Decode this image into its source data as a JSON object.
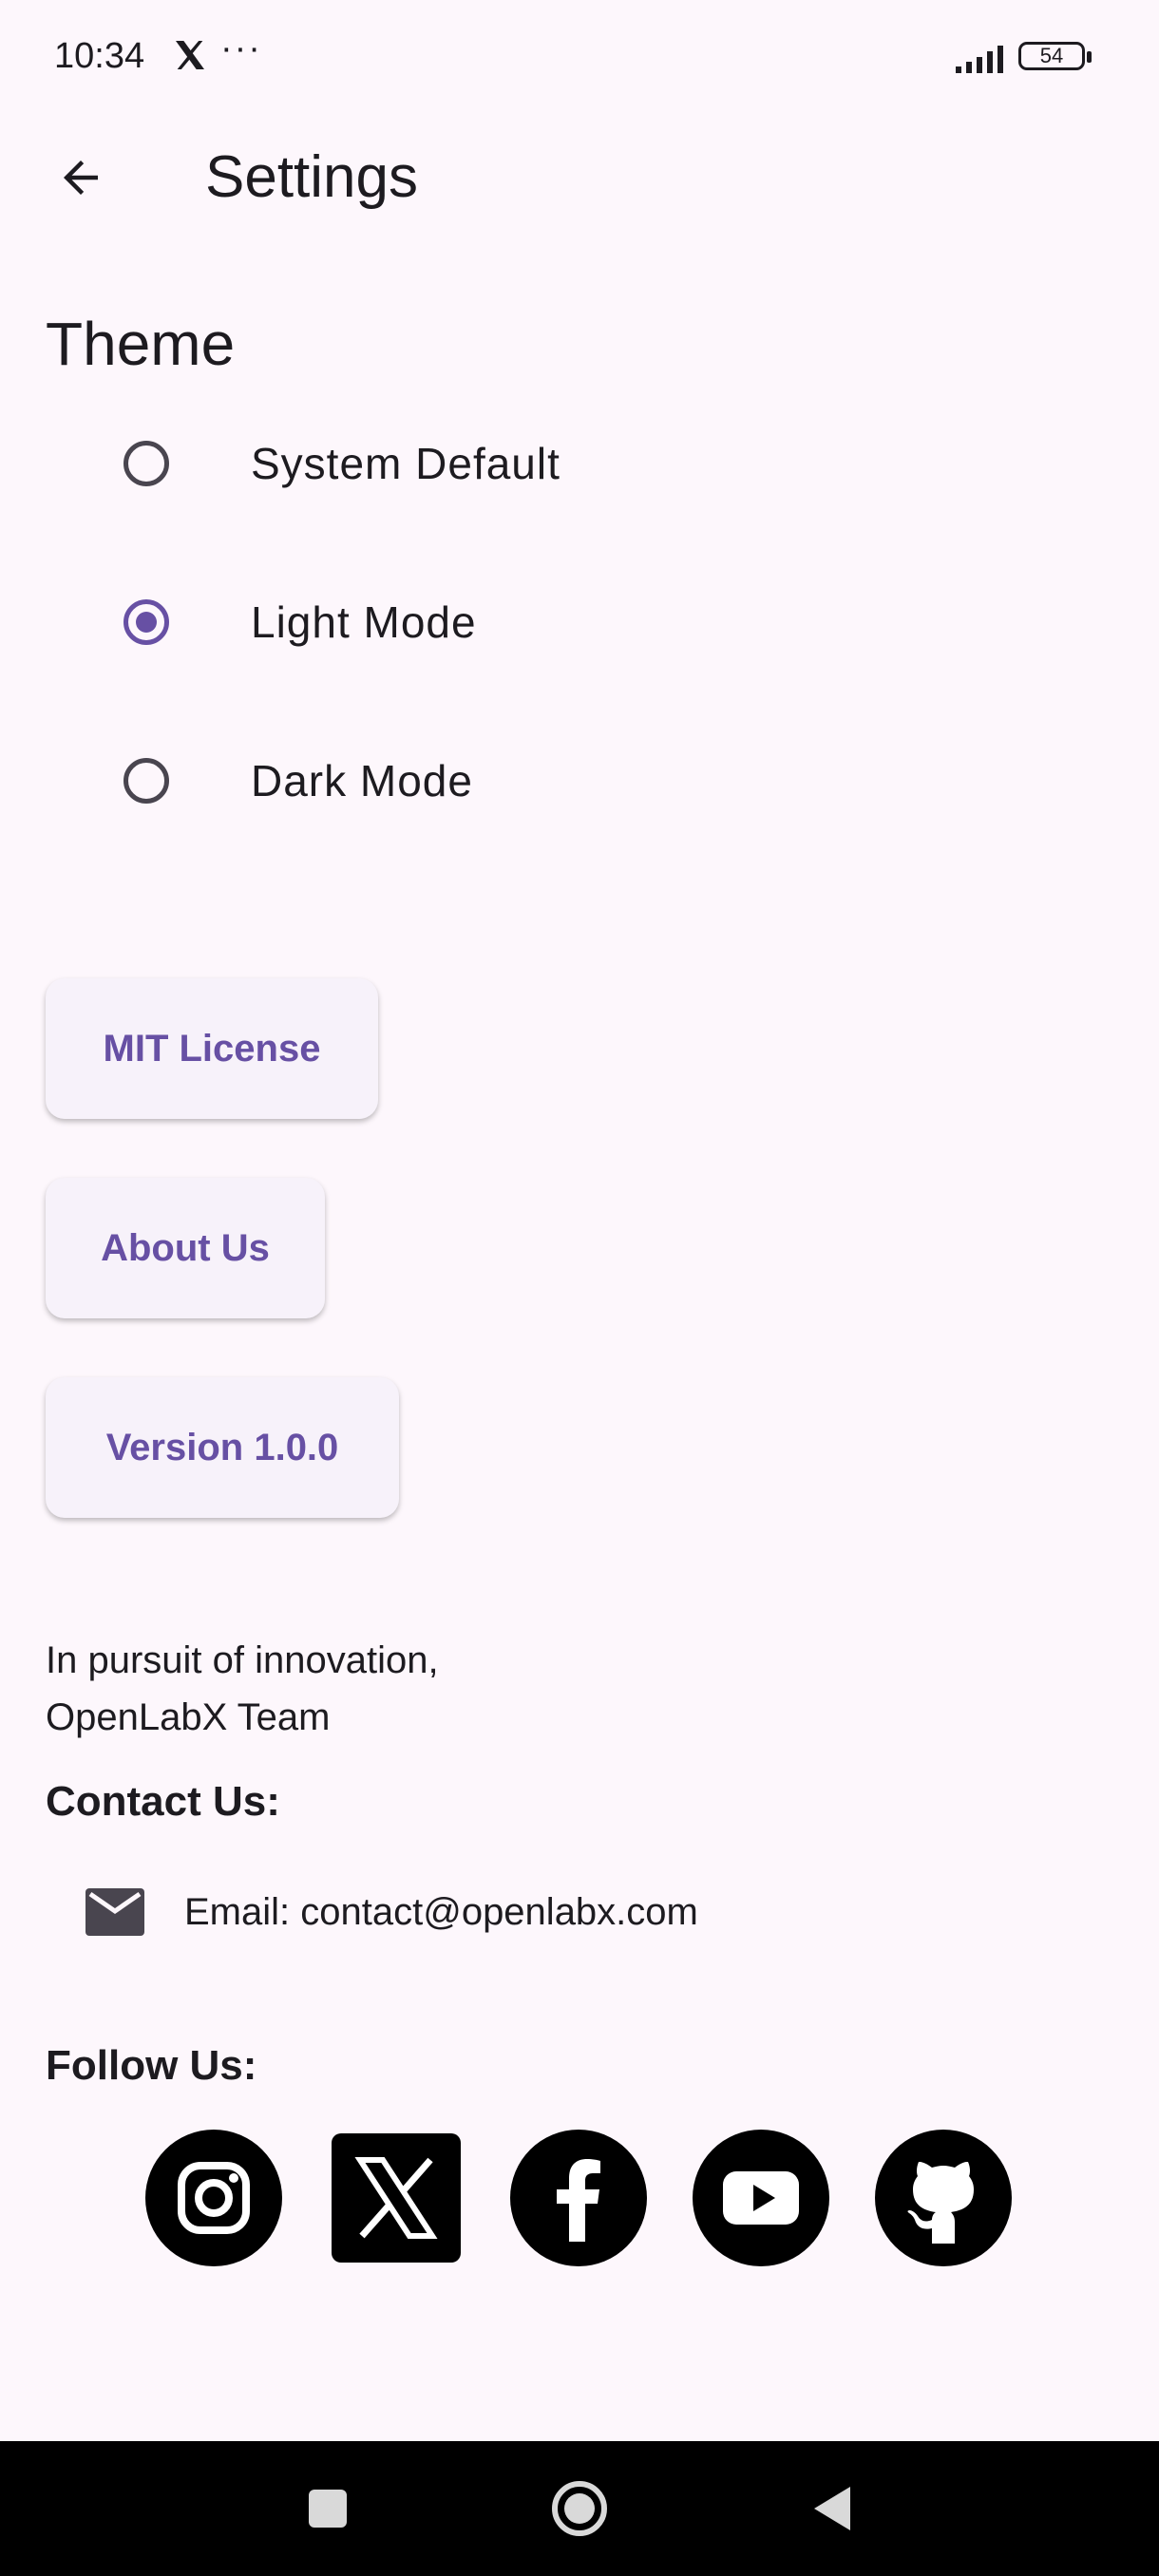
{
  "status_bar": {
    "time": "10:34",
    "more": "···",
    "battery_level": "54"
  },
  "header": {
    "title": "Settings"
  },
  "theme": {
    "section_title": "Theme",
    "options": [
      {
        "label": "System Default",
        "selected": false
      },
      {
        "label": "Light Mode",
        "selected": true
      },
      {
        "label": "Dark Mode",
        "selected": false
      }
    ]
  },
  "buttons": {
    "license": "MIT License",
    "about": "About Us",
    "version": "Version 1.0.0"
  },
  "footer": {
    "tagline_line1": "In pursuit of innovation,",
    "tagline_line2": "OpenLabX Team",
    "contact_title": "Contact Us:",
    "email": "Email: contact@openlabx.com",
    "follow_title": "Follow Us:"
  },
  "social_icons": [
    "instagram-icon",
    "x-icon",
    "facebook-icon",
    "youtube-icon",
    "github-icon"
  ],
  "colors": {
    "accent": "#6750a4",
    "background": "#fdf7fc",
    "button_bg": "#f7f2fa"
  }
}
